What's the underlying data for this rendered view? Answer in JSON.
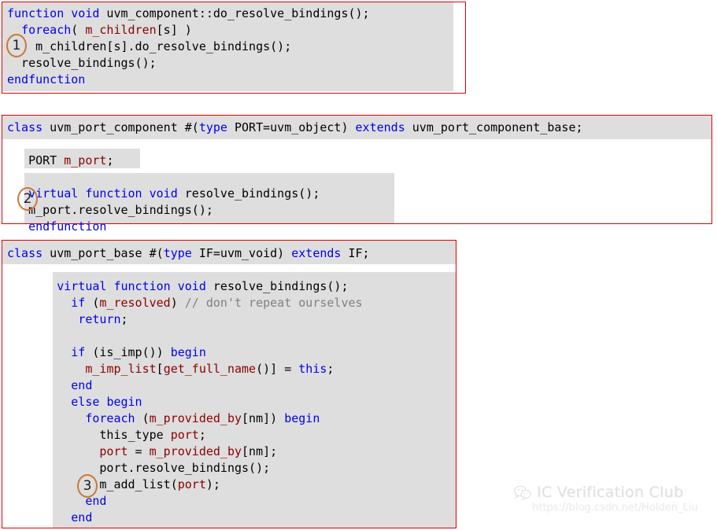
{
  "page": {
    "background": "#ffffff",
    "code_shade_color": "#dedede",
    "border_color": "#e50000",
    "marker_color": "#c8793a",
    "syntax_colors": {
      "keyword": "#0000ee",
      "identifier": "#8b0000",
      "comment": "#808080",
      "plain": "#000000"
    }
  },
  "blocks": [
    {
      "id": "block-1",
      "name": "uvm-component-do-resolve-bindings",
      "lines": [
        [
          {
            "t": "function",
            "c": "kw"
          },
          {
            "t": " ",
            "c": "pln"
          },
          {
            "t": "void",
            "c": "kw"
          },
          {
            "t": " uvm_component::do_resolve_bindings();",
            "c": "pln"
          }
        ],
        [
          {
            "t": "  ",
            "c": "pln"
          },
          {
            "t": "foreach",
            "c": "kw"
          },
          {
            "t": "( ",
            "c": "pln"
          },
          {
            "t": "m_children",
            "c": "id"
          },
          {
            "t": "[s] )",
            "c": "pln"
          }
        ],
        [
          {
            "t": "    m_children[s].do_resolve_bindings();",
            "c": "pln"
          }
        ],
        [
          {
            "t": "  resolve_bindings();",
            "c": "pln"
          }
        ],
        [
          {
            "t": "endfunction",
            "c": "kw"
          }
        ]
      ]
    },
    {
      "id": "block-2",
      "name": "uvm-port-component-class",
      "lines": [
        [
          {
            "t": "class",
            "c": "kw"
          },
          {
            "t": " uvm_port_component #(",
            "c": "pln"
          },
          {
            "t": "type",
            "c": "kw"
          },
          {
            "t": " PORT=uvm_object) ",
            "c": "pln"
          },
          {
            "t": "extends",
            "c": "kw"
          },
          {
            "t": " uvm_port_component_base;",
            "c": "pln"
          }
        ],
        [],
        [
          {
            "t": "   PORT ",
            "c": "pln"
          },
          {
            "t": "m_port",
            "c": "id"
          },
          {
            "t": ";",
            "c": "pln"
          }
        ],
        [],
        [
          {
            "t": "   ",
            "c": "pln"
          },
          {
            "t": "virtual",
            "c": "kw"
          },
          {
            "t": " ",
            "c": "pln"
          },
          {
            "t": "function",
            "c": "kw"
          },
          {
            "t": " ",
            "c": "pln"
          },
          {
            "t": "void",
            "c": "kw"
          },
          {
            "t": " resolve_bindings();",
            "c": "pln"
          }
        ],
        [
          {
            "t": "   m_port.resolve_bindings();",
            "c": "pln"
          }
        ],
        [
          {
            "t": "   ",
            "c": "pln"
          },
          {
            "t": "endfunction",
            "c": "kw"
          }
        ]
      ]
    },
    {
      "id": "block-3",
      "name": "uvm-port-base-class",
      "lines": [
        [
          {
            "t": "class",
            "c": "kw"
          },
          {
            "t": " uvm_port_base #(",
            "c": "pln"
          },
          {
            "t": "type",
            "c": "kw"
          },
          {
            "t": " IF=uvm_void) ",
            "c": "pln"
          },
          {
            "t": "extends",
            "c": "kw"
          },
          {
            "t": " IF;",
            "c": "pln"
          }
        ],
        [],
        [
          {
            "t": "       ",
            "c": "pln"
          },
          {
            "t": "virtual",
            "c": "kw"
          },
          {
            "t": " ",
            "c": "pln"
          },
          {
            "t": "function",
            "c": "kw"
          },
          {
            "t": " ",
            "c": "pln"
          },
          {
            "t": "void",
            "c": "kw"
          },
          {
            "t": " resolve_bindings();",
            "c": "pln"
          }
        ],
        [
          {
            "t": "         ",
            "c": "pln"
          },
          {
            "t": "if",
            "c": "kw"
          },
          {
            "t": " (",
            "c": "pln"
          },
          {
            "t": "m_resolved",
            "c": "id"
          },
          {
            "t": ") ",
            "c": "pln"
          },
          {
            "t": "// don't repeat ourselves",
            "c": "cmt"
          }
        ],
        [
          {
            "t": "          ",
            "c": "pln"
          },
          {
            "t": "return",
            "c": "kw"
          },
          {
            "t": ";",
            "c": "pln"
          }
        ],
        [],
        [
          {
            "t": "         ",
            "c": "pln"
          },
          {
            "t": "if",
            "c": "kw"
          },
          {
            "t": " (is_imp()) ",
            "c": "pln"
          },
          {
            "t": "begin",
            "c": "kw"
          }
        ],
        [
          {
            "t": "           ",
            "c": "pln"
          },
          {
            "t": "m_imp_list",
            "c": "id"
          },
          {
            "t": "[",
            "c": "pln"
          },
          {
            "t": "get_full_name",
            "c": "id"
          },
          {
            "t": "()] = ",
            "c": "pln"
          },
          {
            "t": "this",
            "c": "kw"
          },
          {
            "t": ";",
            "c": "pln"
          }
        ],
        [
          {
            "t": "         ",
            "c": "pln"
          },
          {
            "t": "end",
            "c": "kw"
          }
        ],
        [
          {
            "t": "         ",
            "c": "pln"
          },
          {
            "t": "else",
            "c": "kw"
          },
          {
            "t": " ",
            "c": "pln"
          },
          {
            "t": "begin",
            "c": "kw"
          }
        ],
        [
          {
            "t": "           ",
            "c": "pln"
          },
          {
            "t": "foreach",
            "c": "kw"
          },
          {
            "t": " (",
            "c": "pln"
          },
          {
            "t": "m_provided_by",
            "c": "id"
          },
          {
            "t": "[nm]) ",
            "c": "pln"
          },
          {
            "t": "begin",
            "c": "kw"
          }
        ],
        [
          {
            "t": "             this_type ",
            "c": "pln"
          },
          {
            "t": "port",
            "c": "id"
          },
          {
            "t": ";",
            "c": "pln"
          }
        ],
        [
          {
            "t": "             ",
            "c": "pln"
          },
          {
            "t": "port",
            "c": "id"
          },
          {
            "t": " = ",
            "c": "pln"
          },
          {
            "t": "m_provided_by",
            "c": "id"
          },
          {
            "t": "[nm];",
            "c": "pln"
          }
        ],
        [
          {
            "t": "             port.resolve_bindings();",
            "c": "pln"
          }
        ],
        [
          {
            "t": "             m_add_list(",
            "c": "pln"
          },
          {
            "t": "port",
            "c": "id"
          },
          {
            "t": ");",
            "c": "pln"
          }
        ],
        [
          {
            "t": "           ",
            "c": "pln"
          },
          {
            "t": "end",
            "c": "kw"
          }
        ],
        [
          {
            "t": "         ",
            "c": "pln"
          },
          {
            "t": "end",
            "c": "kw"
          }
        ]
      ]
    }
  ],
  "markers": [
    {
      "id": "marker-1",
      "label": "1"
    },
    {
      "id": "marker-2",
      "label": "2"
    },
    {
      "id": "marker-3",
      "label": "3"
    }
  ],
  "watermark": {
    "icon": "wechat-icon",
    "title": "IC Verification Club",
    "url": "https://blog.csdn.net/Holden_Liu"
  }
}
